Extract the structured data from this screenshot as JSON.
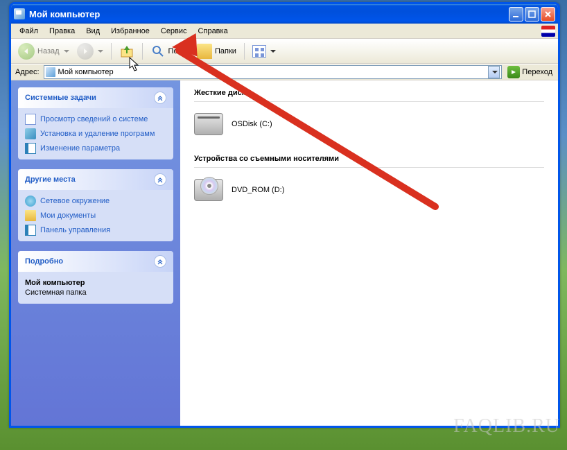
{
  "window": {
    "title": "Мой компьютер"
  },
  "menu": {
    "items": [
      "Файл",
      "Правка",
      "Вид",
      "Избранное",
      "Сервис",
      "Справка"
    ]
  },
  "toolbar": {
    "back": "Назад",
    "search": "Поиск",
    "folders": "Папки"
  },
  "address": {
    "label": "Адрес:",
    "value": "Мой компьютер",
    "go": "Переход"
  },
  "sidebar": {
    "panels": [
      {
        "title": "Системные задачи",
        "links": [
          "Просмотр сведений о системе",
          "Установка и удаление программ",
          "Изменение параметра"
        ]
      },
      {
        "title": "Другие места",
        "links": [
          "Сетевое окружение",
          "Мои документы",
          "Панель управления"
        ]
      },
      {
        "title": "Подробно",
        "details_name": "Мой компьютер",
        "details_type": "Системная папка"
      }
    ]
  },
  "main": {
    "sections": [
      {
        "title": "Жесткие диски",
        "items": [
          {
            "label": "OSDisk (C:)"
          }
        ]
      },
      {
        "title": "Устройства со съемными носителями",
        "items": [
          {
            "label": "DVD_ROM (D:)"
          }
        ]
      }
    ]
  },
  "watermark": "FAQLIB.RU"
}
